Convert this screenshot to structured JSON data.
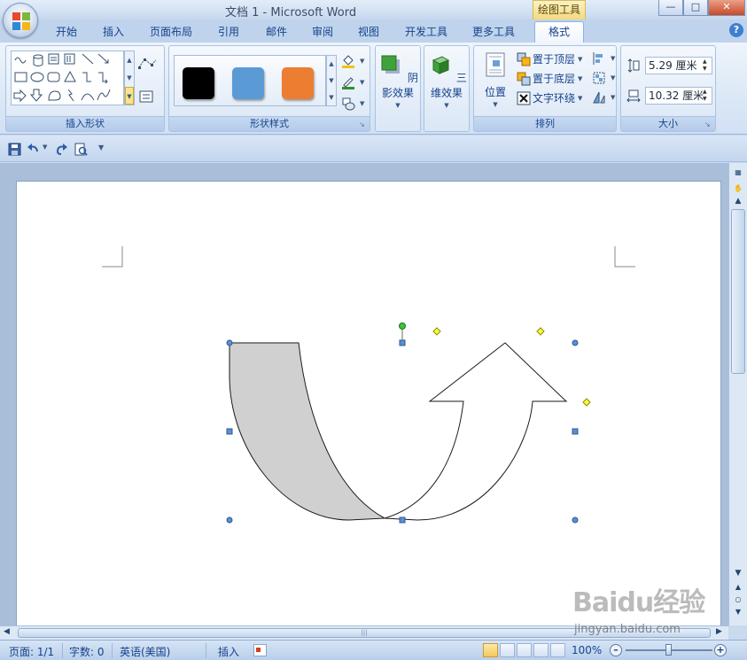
{
  "window": {
    "title": "文档 1 - Microsoft Word",
    "context_tab_title": "绘图工具",
    "controls": [
      "minimize",
      "maximize",
      "close"
    ]
  },
  "tabs": [
    {
      "label": "开始",
      "active": false
    },
    {
      "label": "插入",
      "active": false
    },
    {
      "label": "页面布局",
      "active": false
    },
    {
      "label": "引用",
      "active": false
    },
    {
      "label": "邮件",
      "active": false
    },
    {
      "label": "审阅",
      "active": false
    },
    {
      "label": "视图",
      "active": false
    },
    {
      "label": "开发工具",
      "active": false
    },
    {
      "label": "更多工具",
      "active": false
    },
    {
      "label": "格式",
      "active": true
    }
  ],
  "ribbon": {
    "insert_shapes": {
      "label": "插入形状"
    },
    "shape_styles": {
      "label": "形状样式",
      "swatches": [
        "#000000",
        "#5b9bd5",
        "#ed7d31"
      ]
    },
    "shadow": {
      "label": "阴影效果"
    },
    "threed": {
      "label": "三维效果"
    },
    "arrange": {
      "label": "排列",
      "position": "位置",
      "bring_front": "置于顶层",
      "send_back": "置于底层",
      "text_wrap": "文字环绕"
    },
    "size": {
      "label": "大小",
      "height": "5.29 厘米",
      "width": "10.32 厘米"
    }
  },
  "statusbar": {
    "page": "页面: 1/1",
    "words": "字数: 0",
    "language": "英语(美国)",
    "mode": "插入",
    "zoom": "100%"
  },
  "watermark": {
    "brand": "Baidu经验",
    "url": "jingyan.baidu.com"
  },
  "colors": {
    "shape_fill": "#d0d0d0",
    "handle": "#5b8fd0",
    "adjust_handle": "#ffff33",
    "rotate_handle": "#33cc33"
  }
}
